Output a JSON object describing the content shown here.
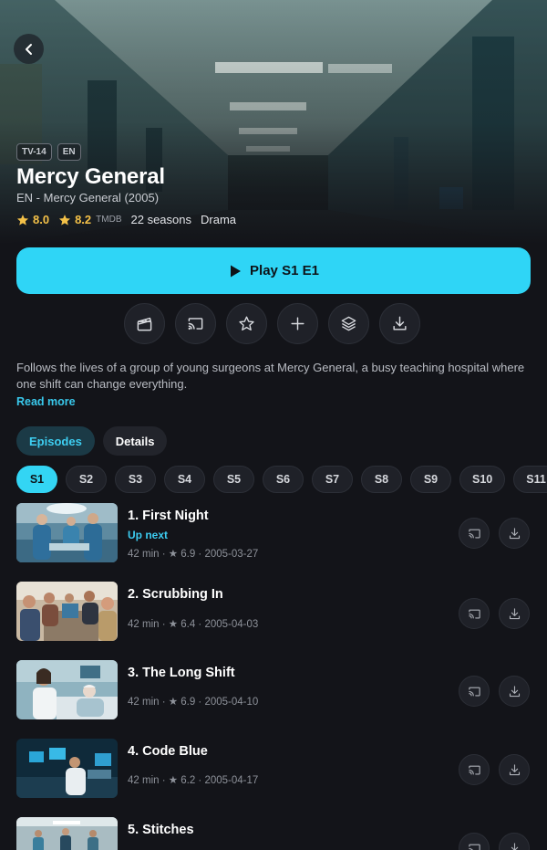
{
  "show": {
    "badges": [
      "TV-14",
      "EN"
    ],
    "title": "Mercy General",
    "subtitle": "EN - Mercy General (2005)",
    "rating_1": {
      "value": "8.0",
      "icon": "star-icon"
    },
    "rating_2": {
      "value": "8.2",
      "source": "TMDB",
      "icon": "star-icon"
    },
    "seasons_count": "22 seasons",
    "genre": "Drama"
  },
  "play": {
    "label": "Play S1 E1",
    "icon": "play-icon"
  },
  "actions": [
    {
      "name": "clapperboard-icon"
    },
    {
      "name": "cast-icon"
    },
    {
      "name": "star-outline-icon"
    },
    {
      "name": "plus-icon"
    },
    {
      "name": "layers-icon"
    },
    {
      "name": "download-icon"
    }
  ],
  "description": "Follows the lives of a group of young surgeons at Mercy General, a busy teaching hospital where one shift can change everything.",
  "read_more": "Read more",
  "tabs": [
    {
      "label": "Episodes",
      "active": true
    },
    {
      "label": "Details",
      "active": false
    }
  ],
  "seasons": [
    "S1",
    "S2",
    "S3",
    "S4",
    "S5",
    "S6",
    "S7",
    "S8",
    "S9",
    "S10",
    "S11"
  ],
  "active_season": "S1",
  "episodes": [
    {
      "title": "1. First Night",
      "up_next": "Up next",
      "meta": "42 min · ★ 6.9 · 2005-03-27"
    },
    {
      "title": "2. Scrubbing In",
      "meta": "42 min · ★ 6.4 · 2005-04-03"
    },
    {
      "title": "3. The Long Shift",
      "meta": "42 min · ★ 6.9 · 2005-04-10"
    },
    {
      "title": "4. Code Blue",
      "meta": "42 min · ★ 6.2 · 2005-04-17"
    },
    {
      "title": "5. Stitches",
      "meta": ""
    }
  ],
  "colors": {
    "accent": "#2fd5f6",
    "background": "#131419",
    "rating": "#f4c148"
  }
}
